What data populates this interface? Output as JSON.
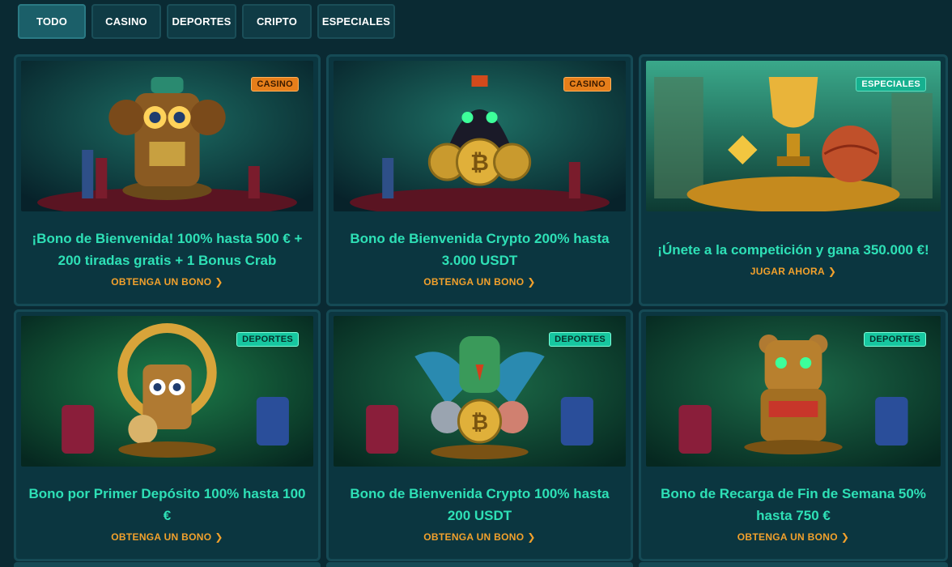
{
  "tabs": [
    {
      "label": "TODO",
      "active": true
    },
    {
      "label": "CASINO",
      "active": false
    },
    {
      "label": "DEPORTES",
      "active": false
    },
    {
      "label": "CRIPTO",
      "active": false
    },
    {
      "label": "ESPECIALES",
      "active": false
    }
  ],
  "cards": [
    {
      "badge": "CASINO",
      "badge_type": "casino",
      "title": "¡Bono de Bienvenida! 100% hasta 500 € + 200 tiradas gratis + 1 Bonus Crab",
      "cta": "OBTENGA UN BONO",
      "icon": "monkey-totem-icon"
    },
    {
      "badge": "CASINO",
      "badge_type": "casino",
      "title": "Bono de Bienvenida Crypto 200% hasta 3.000 USDT",
      "cta": "OBTENGA UN BONO",
      "icon": "panther-crypto-icon"
    },
    {
      "badge": "ESPECIALES",
      "badge_type": "especiales",
      "title": "¡Únete a la competición y gana 350.000 €!",
      "cta": "JUGAR AHORA",
      "icon": "trophy-icon"
    },
    {
      "badge": "DEPORTES",
      "badge_type": "deportes",
      "title": "Bono por Primer Depósito 100% hasta 100 €",
      "cta": "OBTENGA UN BONO",
      "icon": "sloth-football-icon"
    },
    {
      "badge": "DEPORTES",
      "badge_type": "deportes",
      "title": "Bono de Bienvenida Crypto 100% hasta 200 USDT",
      "cta": "OBTENGA UN BONO",
      "icon": "parrot-crypto-icon"
    },
    {
      "badge": "DEPORTES",
      "badge_type": "deportes",
      "title": "Bono de Recarga de Fin de Semana 50% hasta 750 €",
      "cta": "OBTENGA UN BONO",
      "icon": "bear-totem-icon"
    }
  ],
  "colors": {
    "background": "#0a2a33",
    "title": "#2ee0b6",
    "cta": "#f2a12c",
    "badge_casino": "#e67e1a",
    "badge_deportes": "#17c7a0"
  }
}
